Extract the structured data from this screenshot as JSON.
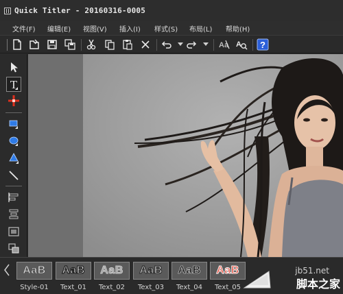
{
  "window": {
    "title": "Quick Titler - 20160316-0005"
  },
  "menu": {
    "items": [
      {
        "label": "文件(F)"
      },
      {
        "label": "编辑(E)"
      },
      {
        "label": "视图(V)"
      },
      {
        "label": "插入(I)"
      },
      {
        "label": "样式(S)"
      },
      {
        "label": "布局(L)"
      },
      {
        "label": "帮助(H)"
      }
    ]
  },
  "toolbar": {
    "icons": [
      "new-icon",
      "open-icon",
      "save-icon",
      "save-all-icon",
      "cut-icon",
      "copy-icon",
      "paste-icon",
      "delete-icon",
      "undo-icon",
      "redo-icon",
      "text-effect-icon",
      "text-preview-icon",
      "help-icon"
    ]
  },
  "palette": {
    "tools": [
      "select-arrow-icon",
      "text-tool-icon",
      "crosshair-tool-icon",
      "rectangle-tool-icon",
      "ellipse-tool-icon",
      "triangle-tool-icon",
      "line-tool-icon",
      "align-left-icon",
      "align-center-icon",
      "frame-tool-icon",
      "layer-tool-icon"
    ],
    "active": "text-tool-icon"
  },
  "styles": {
    "swatches": [
      {
        "preview": "AaB",
        "label": "Style-01",
        "fill": "#eaeaea",
        "stroke": "#555555"
      },
      {
        "preview": "AaB",
        "label": "Text_01",
        "fill": "#ffffff",
        "stroke": "#222222"
      },
      {
        "preview": "AaB",
        "label": "Text_02",
        "fill": "#9a9a9a",
        "stroke": "#c8c8c8"
      },
      {
        "preview": "AaB",
        "label": "Text_03",
        "fill": "#f4f4f4",
        "stroke": "#333333"
      },
      {
        "preview": "AaB",
        "label": "Text_04",
        "fill": "#111111",
        "stroke": "#dddddd"
      },
      {
        "preview": "AaB",
        "label": "Text_05",
        "fill": "#e0301e",
        "stroke": "#ffffff"
      }
    ]
  },
  "watermark": {
    "url": "jb51.net",
    "text": "脚本之家"
  },
  "colors": {
    "chrome": "#2b2b2b",
    "canvas_safe_area": "#6f6f6f",
    "help_icon": "#2b5fd9",
    "shape_blue": "#2f7be6",
    "crosshair_red": "#e0301e"
  }
}
